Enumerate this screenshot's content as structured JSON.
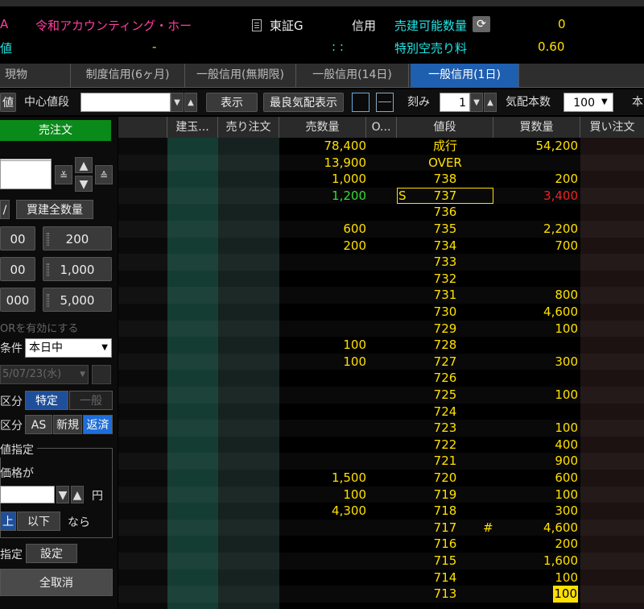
{
  "header": {
    "prefix": "A",
    "stock_name": "令和アカウンティング・ホー",
    "market": "東証G",
    "credit_label": "信用",
    "sell_available_label": "売建可能数量",
    "sell_available_value": "0",
    "row2_prefix": "値",
    "row2_dash": "-",
    "row2_colon": ": :",
    "special_fee_label": "特別空売り料",
    "special_fee_value": "0.60"
  },
  "tabs": [
    {
      "label": "現物"
    },
    {
      "label": "制度信用(6ヶ月)"
    },
    {
      "label": "一般信用(無期限)"
    },
    {
      "label": "一般信用(14日)"
    },
    {
      "label": "一般信用(1日)"
    }
  ],
  "toolbar": {
    "left_label": "値",
    "center_price_label": "中心値段",
    "center_price_value": "",
    "show_button": "表示",
    "best_quote_button": "最良気配表示",
    "tick_label": "刻み",
    "tick_value": "1",
    "quote_count_label": "気配本数",
    "quote_count_value": "100",
    "trailing_label": "本"
  },
  "left": {
    "sell_order_header": "売注文",
    "buy_all_qty": "買建全数量",
    "q_left": [
      "00",
      "00",
      "000"
    ],
    "q_right": [
      "200",
      "1,000",
      "5,000"
    ],
    "or_enable": "ORを有効にする",
    "condition_label": "条件",
    "condition_value": "本日中",
    "date_value": "5/07/23(水)",
    "div1_label": "区分",
    "div1_opt1": "特定",
    "div1_opt2": "一般",
    "div2_label": "区分",
    "div2_opt1": "AS",
    "div2_opt2": "新規",
    "div2_opt3": "返済",
    "price_spec_label": "値指定",
    "price_if_label": "価格が",
    "yen_label": "円",
    "above_label": "上",
    "below_label": "以下",
    "then_label": "なら",
    "spec_label": "指定",
    "set_button": "設定",
    "cancel_all_button": "全取消"
  },
  "columns": [
    "建玉...",
    "売り注文",
    "売数量",
    "O...",
    "値段",
    "買数量",
    "買い注文"
  ],
  "rows": [
    {
      "sell": "78,400",
      "price": "成行",
      "buy": "54,200"
    },
    {
      "sell": "13,900",
      "price": "OVER",
      "buy": ""
    },
    {
      "sell": "1,000",
      "price": "738",
      "buy": "200"
    },
    {
      "sell": "1,200",
      "sell_color": "#33dd33",
      "mark": "S",
      "price": "737",
      "buy": "3,400",
      "buy_color": "#ee2222",
      "boxed": true
    },
    {
      "sell": "",
      "price": "736",
      "buy": ""
    },
    {
      "sell": "600",
      "price": "735",
      "buy": "2,200"
    },
    {
      "sell": "200",
      "price": "734",
      "buy": "700"
    },
    {
      "sell": "",
      "price": "733",
      "buy": ""
    },
    {
      "sell": "",
      "price": "732",
      "buy": ""
    },
    {
      "sell": "",
      "price": "731",
      "buy": "800"
    },
    {
      "sell": "",
      "price": "730",
      "buy": "4,600"
    },
    {
      "sell": "",
      "price": "729",
      "buy": "100"
    },
    {
      "sell": "100",
      "price": "728",
      "buy": ""
    },
    {
      "sell": "100",
      "price": "727",
      "buy": "300"
    },
    {
      "sell": "",
      "price": "726",
      "buy": ""
    },
    {
      "sell": "",
      "price": "725",
      "buy": "100"
    },
    {
      "sell": "",
      "price": "724",
      "buy": ""
    },
    {
      "sell": "",
      "price": "723",
      "buy": "100"
    },
    {
      "sell": "",
      "price": "722",
      "buy": "400"
    },
    {
      "sell": "",
      "price": "721",
      "buy": "900"
    },
    {
      "sell": "1,500",
      "price": "720",
      "buy": "600"
    },
    {
      "sell": "100",
      "price": "719",
      "buy": "100"
    },
    {
      "sell": "4,300",
      "price": "718",
      "buy": "300"
    },
    {
      "sell": "",
      "price": "717",
      "hash": "#",
      "buy": "4,600"
    },
    {
      "sell": "",
      "price": "716",
      "buy": "200"
    },
    {
      "sell": "",
      "price": "715",
      "buy": "1,600"
    },
    {
      "sell": "",
      "price": "714",
      "buy": "100"
    },
    {
      "sell": "",
      "price": "713",
      "buy": "100",
      "buy_highlight": true
    }
  ]
}
